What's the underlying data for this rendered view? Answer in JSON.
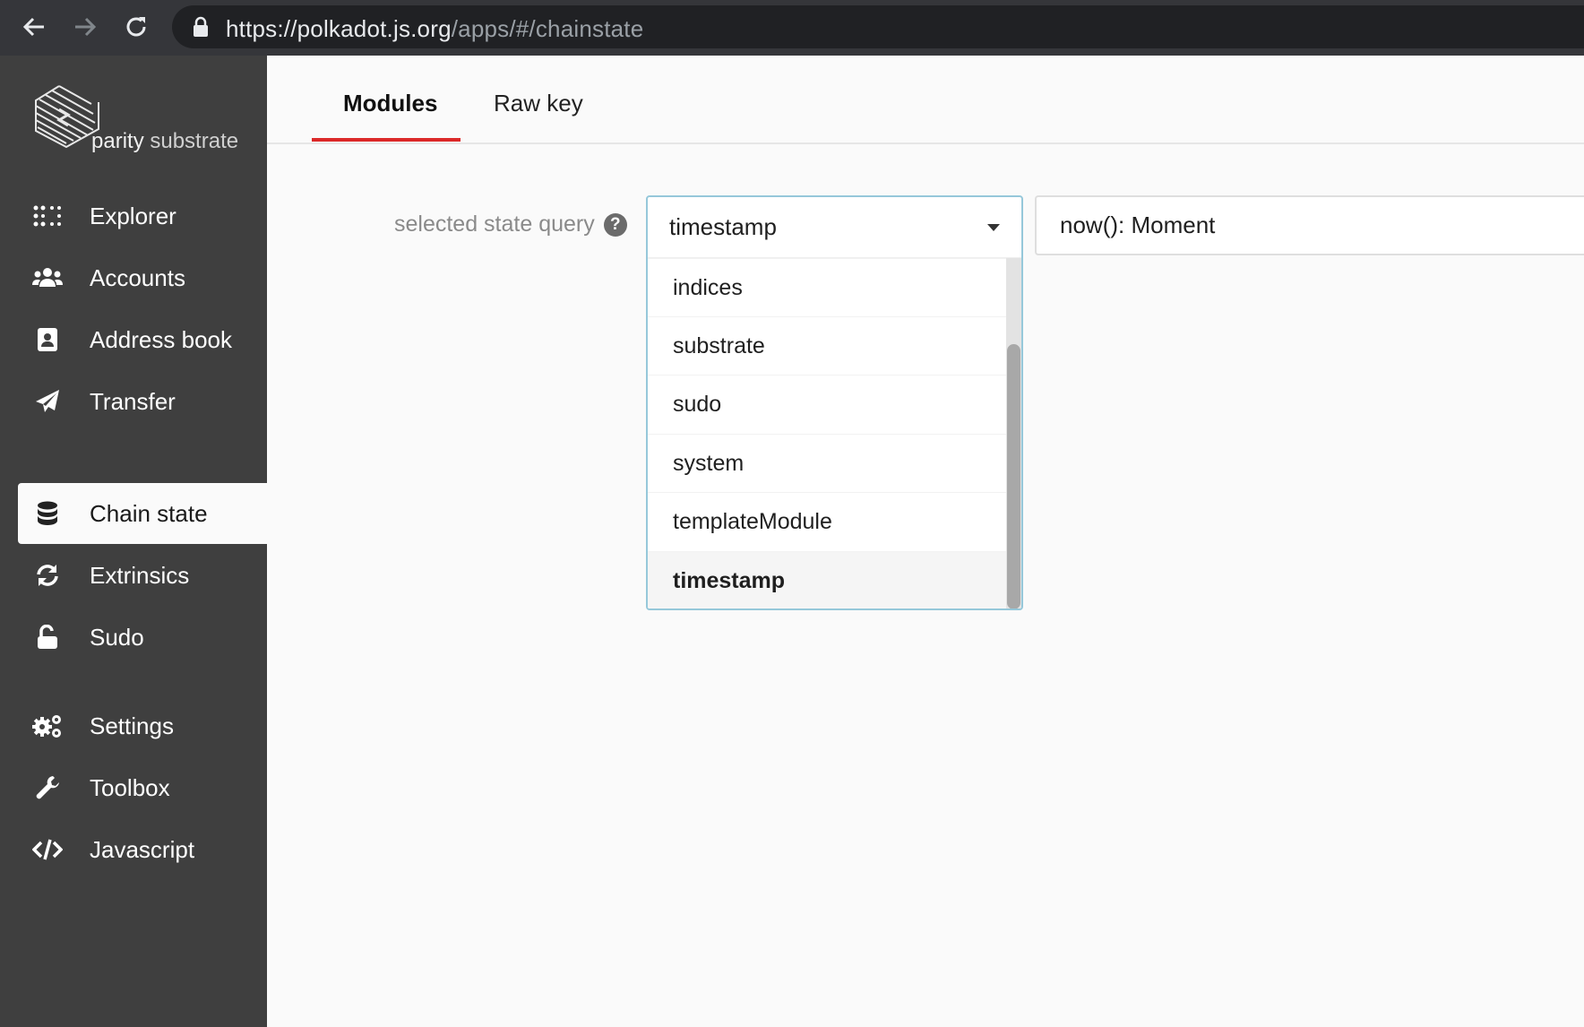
{
  "browser": {
    "url_main": "https://polkadot.js.org",
    "url_path": "/apps/#/chainstate"
  },
  "sidebar": {
    "logo": {
      "brand": "parity",
      "product": "substrate"
    },
    "items": [
      {
        "label": "Explorer",
        "icon": "explorer-icon"
      },
      {
        "label": "Accounts",
        "icon": "users-icon"
      },
      {
        "label": "Address book",
        "icon": "address-book-icon"
      },
      {
        "label": "Transfer",
        "icon": "paper-plane-icon"
      },
      {
        "label": "Chain state",
        "icon": "database-icon",
        "active": true
      },
      {
        "label": "Extrinsics",
        "icon": "sync-icon"
      },
      {
        "label": "Sudo",
        "icon": "unlock-icon"
      },
      {
        "label": "Settings",
        "icon": "cogs-icon"
      },
      {
        "label": "Toolbox",
        "icon": "wrench-icon"
      },
      {
        "label": "Javascript",
        "icon": "code-icon"
      }
    ]
  },
  "tabs": [
    {
      "label": "Modules",
      "active": true
    },
    {
      "label": "Raw key",
      "active": false
    }
  ],
  "query": {
    "label": "selected state query",
    "help_glyph": "?",
    "module_selected": "timestamp",
    "module_options": [
      "indices",
      "substrate",
      "sudo",
      "system",
      "templateModule",
      "timestamp"
    ],
    "method_value": "now(): Moment"
  },
  "colors": {
    "sidebar_bg": "#3f3f3f",
    "accent_red": "#db2828",
    "dropdown_border": "#96c8da"
  }
}
